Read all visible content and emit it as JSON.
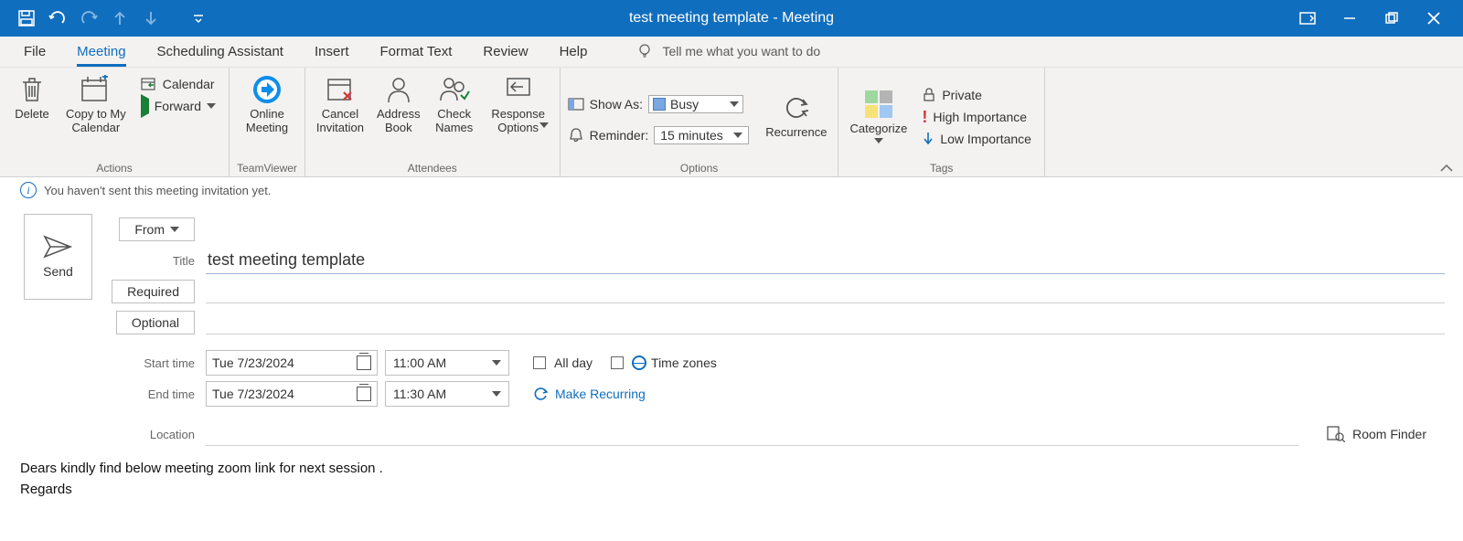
{
  "window": {
    "title_doc": "test meeting template",
    "title_sep": " - ",
    "title_type": "Meeting"
  },
  "tabs": {
    "file": "File",
    "meeting": "Meeting",
    "scheduling": "Scheduling Assistant",
    "insert": "Insert",
    "format": "Format Text",
    "review": "Review",
    "help": "Help",
    "tellme": "Tell me what you want to do"
  },
  "ribbon": {
    "actions": {
      "label": "Actions",
      "delete": "Delete",
      "copy": "Copy to My\nCalendar",
      "calendar": "Calendar",
      "forward": "Forward"
    },
    "teamviewer": {
      "label": "TeamViewer",
      "online_meeting": "Online\nMeeting"
    },
    "attendees": {
      "label": "Attendees",
      "cancel": "Cancel\nInvitation",
      "addressbook": "Address\nBook",
      "checknames": "Check\nNames",
      "response": "Response\nOptions"
    },
    "options": {
      "label": "Options",
      "showas_lbl": "Show As:",
      "showas_value": "Busy",
      "reminder_lbl": "Reminder:",
      "reminder_value": "15 minutes",
      "recurrence": "Recurrence"
    },
    "tags": {
      "label": "Tags",
      "categorize": "Categorize",
      "private": "Private",
      "high": "High Importance",
      "low": "Low Importance"
    }
  },
  "infobar": "You haven't sent this meeting invitation yet.",
  "form": {
    "send": "Send",
    "from": "From",
    "title_lbl": "Title",
    "title_val": "test meeting template",
    "required": "Required",
    "optional": "Optional",
    "start_lbl": "Start time",
    "start_date": "Tue 7/23/2024",
    "start_time": "11:00 AM",
    "end_lbl": "End time",
    "end_date": "Tue 7/23/2024",
    "end_time": "11:30 AM",
    "allday": "All day",
    "timezones": "Time zones",
    "recurring": "Make Recurring",
    "location_lbl": "Location",
    "roomfinder": "Room Finder"
  },
  "body": {
    "line1": "Dears kindly find below meeting zoom link for next session .",
    "line2": "Regards"
  }
}
